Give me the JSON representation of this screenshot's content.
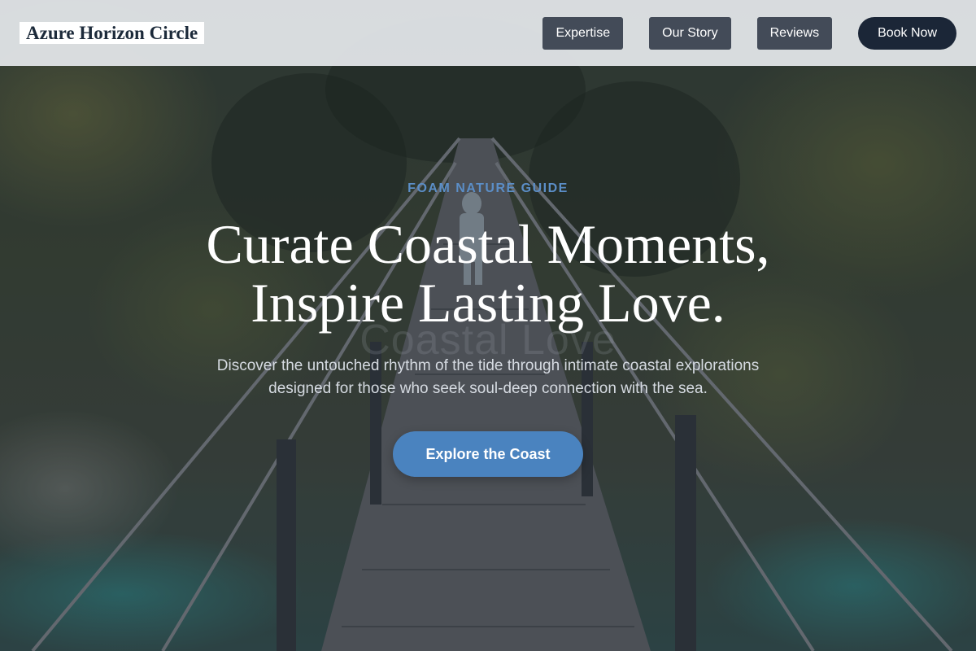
{
  "header": {
    "logo": "Azure Horizon Circle",
    "nav": [
      {
        "label": "Expertise"
      },
      {
        "label": "Our Story"
      },
      {
        "label": "Reviews"
      }
    ],
    "book_label": "Book Now"
  },
  "hero": {
    "eyebrow": "FOAM NATURE GUIDE",
    "headline_line1": "Curate Coastal Moments,",
    "headline_line2": "Inspire Lasting Love.",
    "ghost_text": "Coastal Love",
    "subhead": "Discover the untouched rhythm of the tide through intimate coastal explorations designed for those who seek soul-deep connection with the sea.",
    "cta_label": "Explore the Coast"
  },
  "colors": {
    "header_bg": "#e2e5e8",
    "nav_button": "#434b58",
    "book_button": "#1b2637",
    "eyebrow": "#5b8ec7",
    "cta": "#4a83bf"
  },
  "background_image": "forest suspension bridge over turquoise river"
}
